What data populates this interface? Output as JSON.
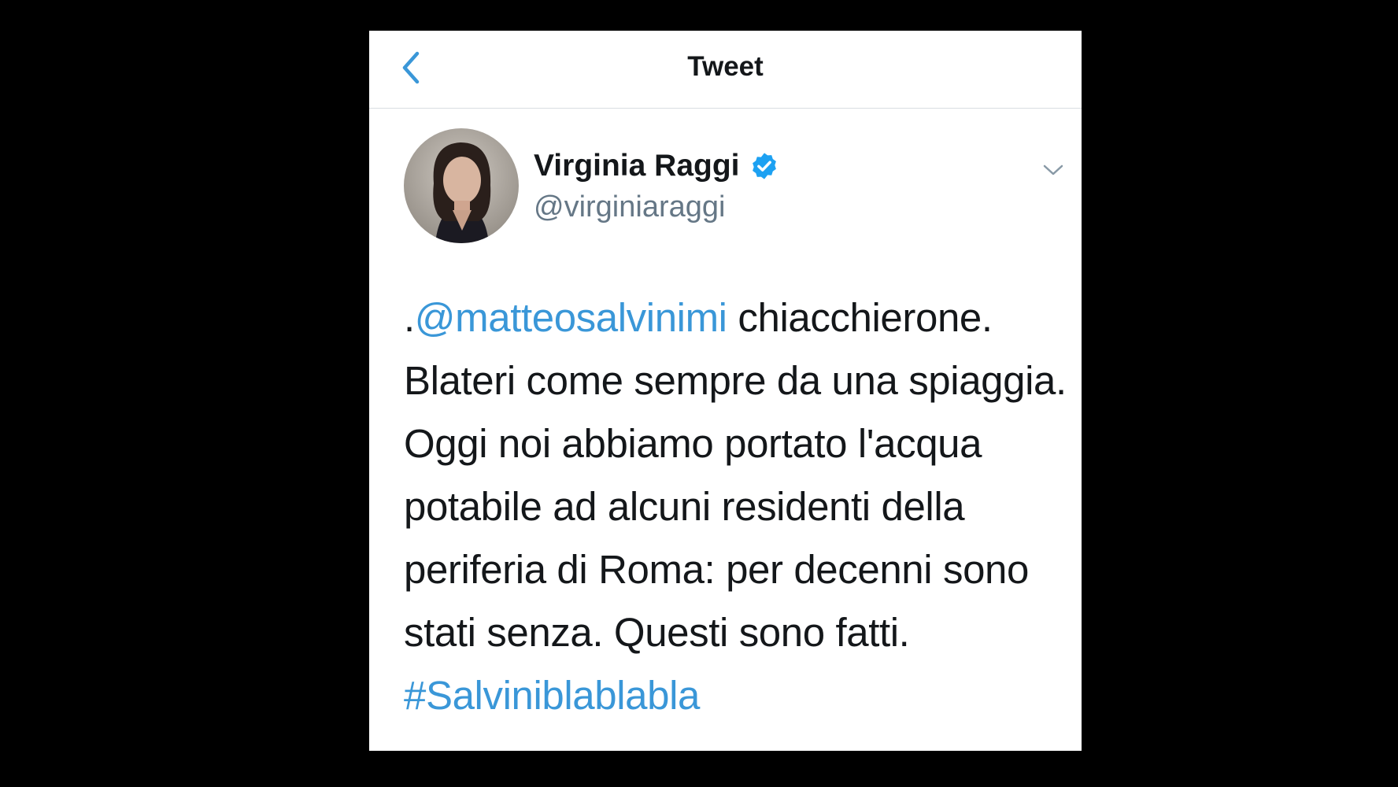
{
  "nav": {
    "title": "Tweet"
  },
  "author": {
    "display_name": "Virginia Raggi",
    "handle": "@virginiaraggi",
    "verified": true
  },
  "tweet": {
    "prefix": ".",
    "mention": "@matteosalvinimi",
    "text_after_mention": " chiacchierone. Blateri come sempre da una spiaggia. Oggi noi abbiamo portato l'acqua potabile ad alcuni residenti della periferia di Roma: per decenni sono stati senza. Questi sono fatti. ",
    "hashtag": "#Salviniblablabla"
  },
  "icons": {
    "back": "chevron-left-icon",
    "verified": "verified-badge-icon",
    "menu": "chevron-down-icon"
  },
  "colors": {
    "link": "#3a97d8",
    "text": "#14171a",
    "secondary": "#657786",
    "verified": "#1da1f2"
  }
}
